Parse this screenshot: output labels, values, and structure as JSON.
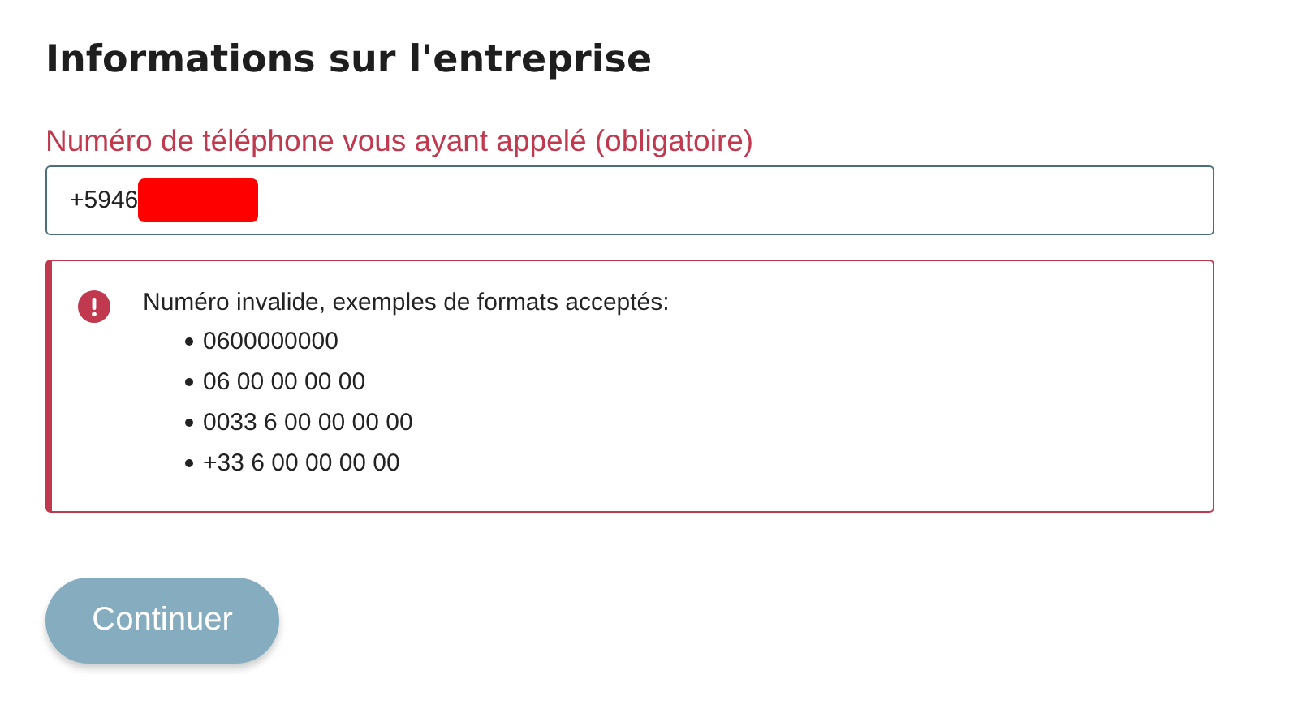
{
  "heading": "Informations sur l'entreprise",
  "phone_field": {
    "label": "Numéro de téléphone vous ayant appelé (obligatoire)",
    "value": "+5946",
    "redacted": true,
    "invalid": true
  },
  "error": {
    "message": "Numéro invalide, exemples de formats acceptés:",
    "examples": [
      "0600000000",
      "06 00 00 00 00",
      "0033 6 00 00 00 00",
      "+33 6 00 00 00 00"
    ]
  },
  "continue_button": {
    "label": "Continuer",
    "disabled": true
  }
}
